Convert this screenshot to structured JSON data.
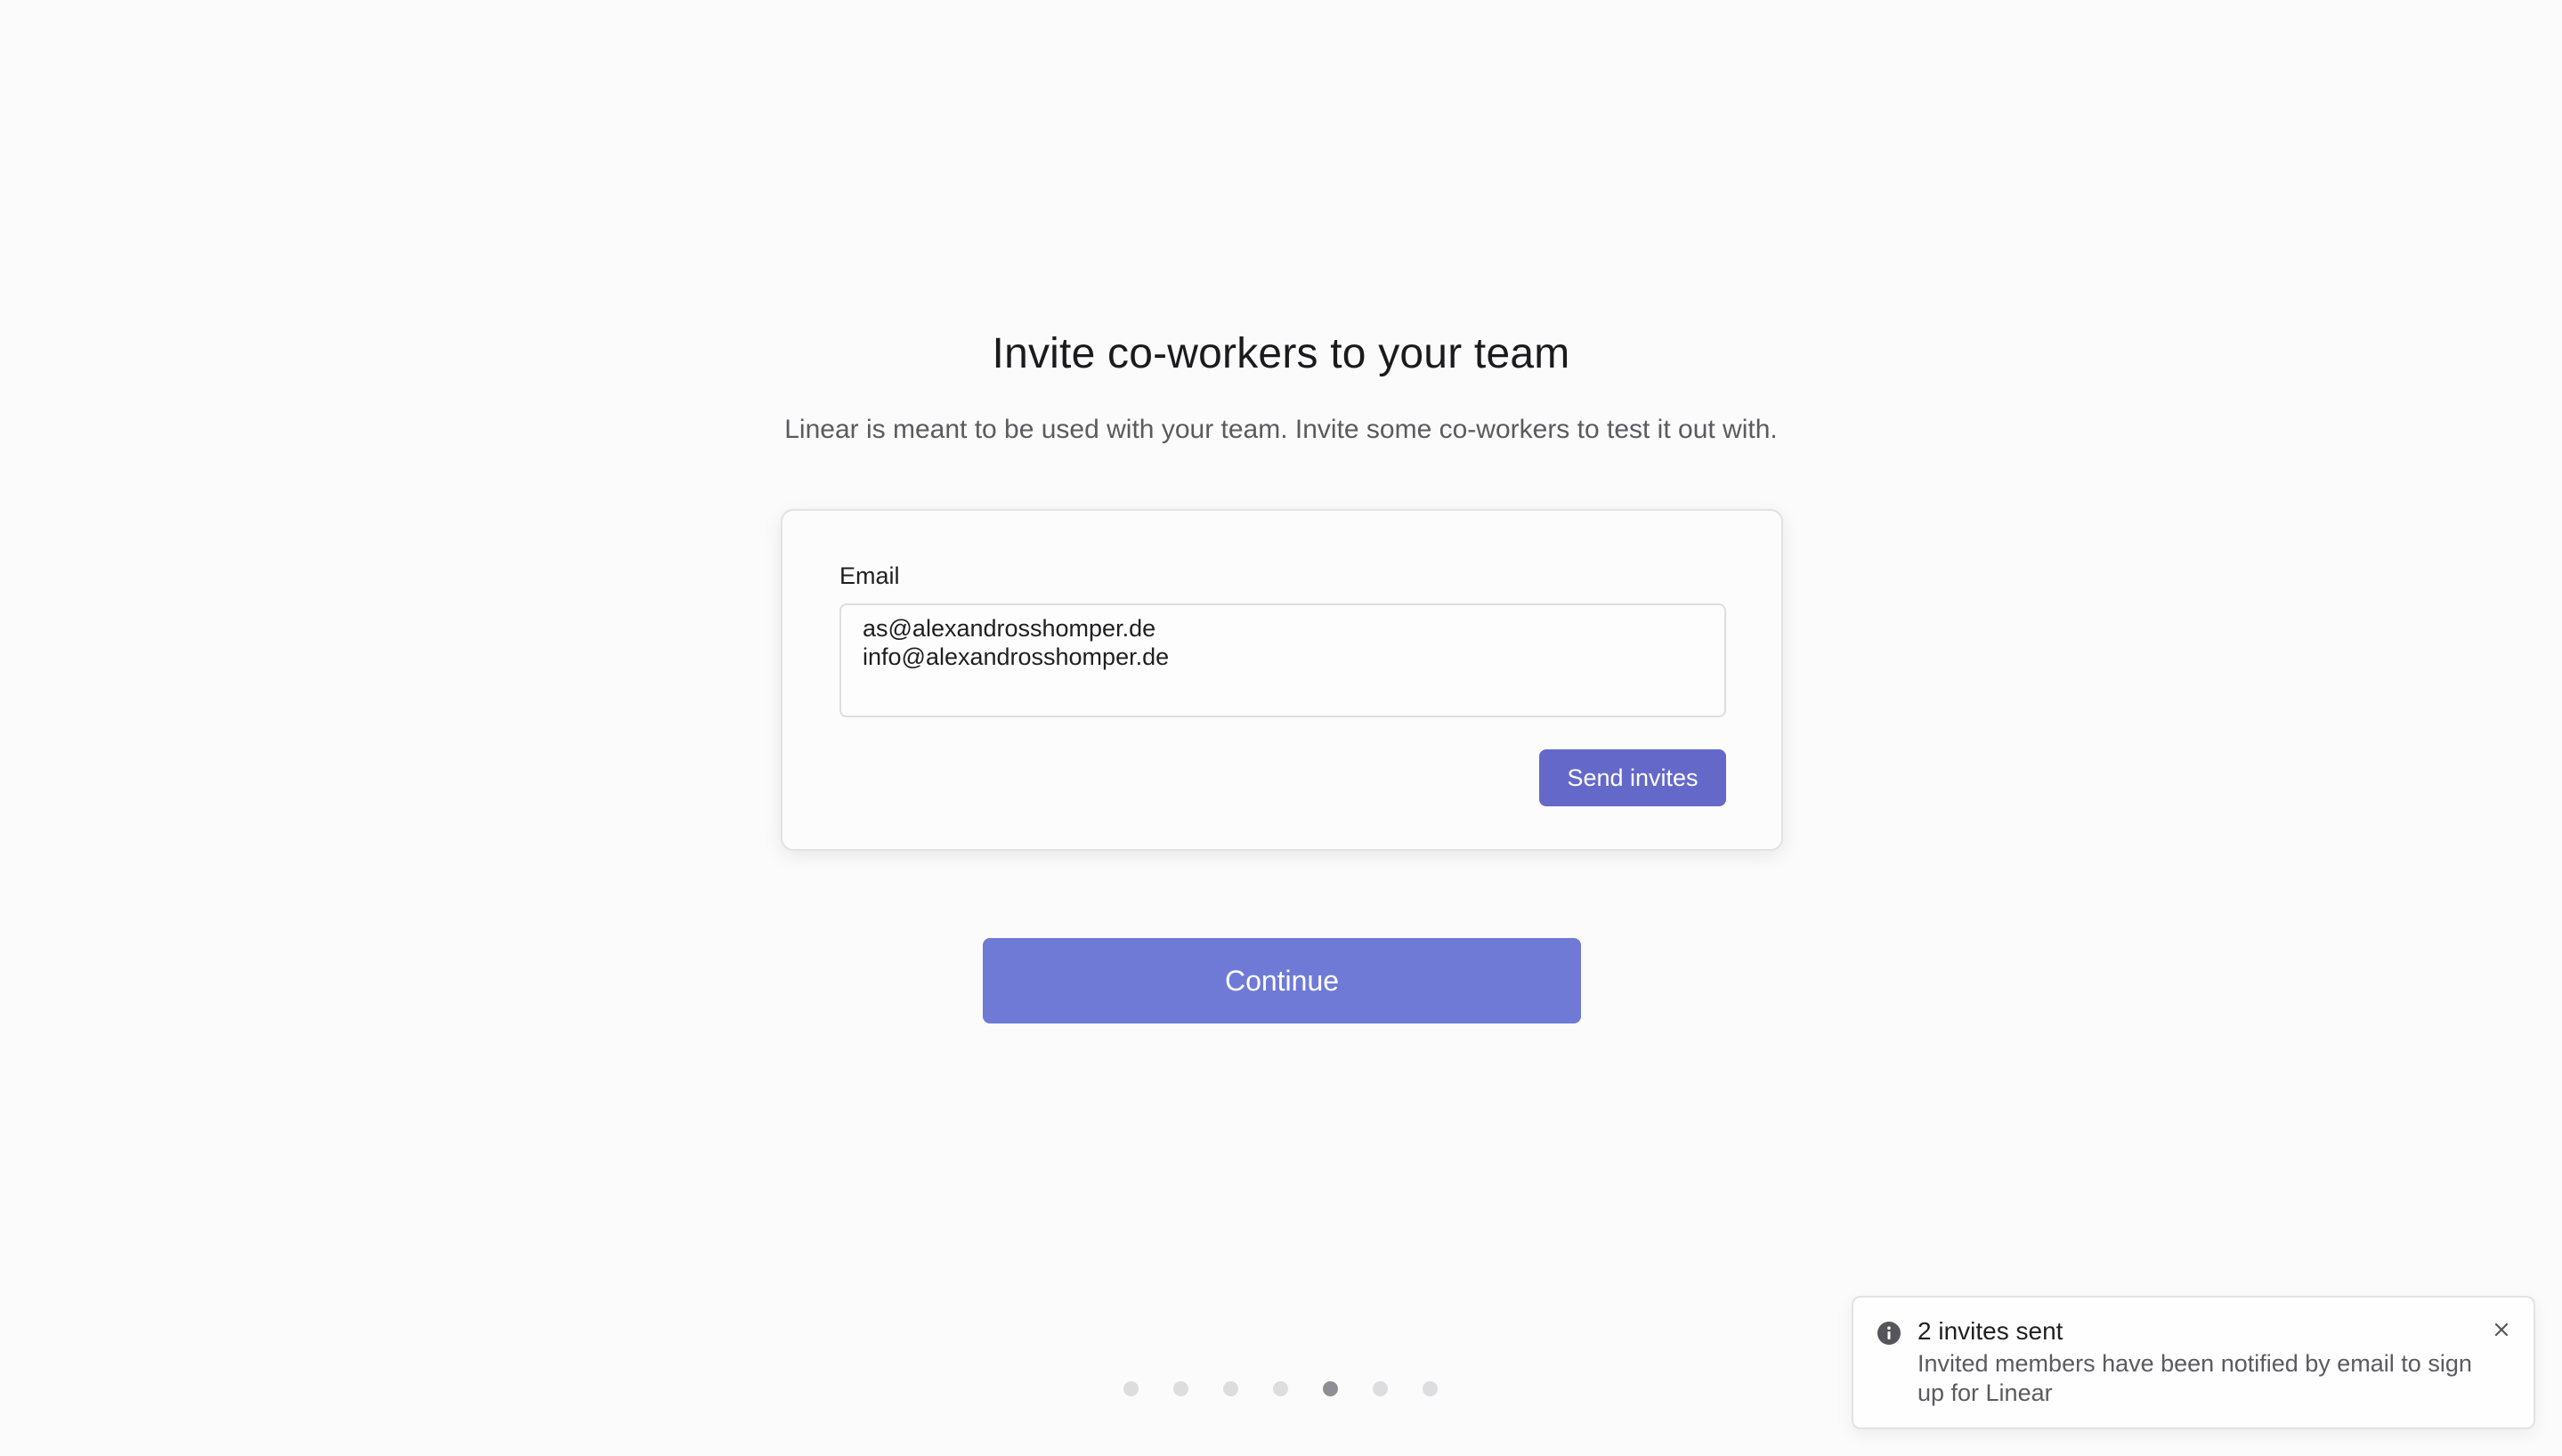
{
  "header": {
    "title": "Invite co-workers to your team",
    "subtitle": "Linear is meant to be used with your team. Invite some co-workers to test it out with."
  },
  "invite_form": {
    "email_label": "Email",
    "email_value": "as@alexandrosshomper.de\ninfo@alexandrosshomper.de",
    "send_label": "Send invites"
  },
  "continue_label": "Continue",
  "progress": {
    "total_steps": 7,
    "current_step": 5
  },
  "toast": {
    "icon": "info-icon",
    "title": "2 invites sent",
    "body": "Invited members have been notified by email to sign up for Linear",
    "close_icon": "close-icon"
  },
  "colors": {
    "primary": "#6469c9",
    "continue": "#6f7ad6",
    "dot_active": "#8e8e94",
    "dot_inactive": "#dddde0"
  }
}
